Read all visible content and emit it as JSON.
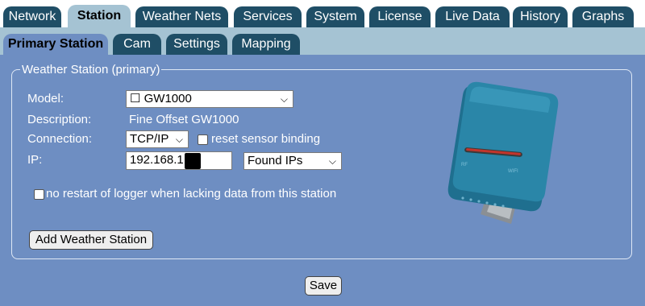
{
  "top_tabs": [
    "Network",
    "Station",
    "Weather Nets",
    "Services",
    "System",
    "License",
    "Live Data",
    "History",
    "Graphs"
  ],
  "sub_tabs": [
    "Primary Station",
    "Cam",
    "Settings",
    "Mapping"
  ],
  "form": {
    "legend": "Weather Station (primary)",
    "model_label": "Model:",
    "model_value": "☐ GW1000",
    "description_label": "Description:",
    "description_value": "Fine Offset GW1000",
    "connection_label": "Connection:",
    "connection_value": "TCP/IP",
    "reset_binding_label": "reset sensor binding",
    "ip_label": "IP:",
    "ip_value": "192.168.1.",
    "found_ips_value": "Found IPs",
    "no_restart_label": "no restart of logger when lacking data from this station",
    "add_station_button": "Add Weather Station"
  },
  "save_button": "Save",
  "device_labels": {
    "left": "RF",
    "right": "WIFI"
  },
  "colors": {
    "tab_dark": "#1f4e66",
    "tab_light": "#a5c3d3",
    "panel_blue": "#6e8ec2",
    "device_teal": "#2a7fa0"
  }
}
